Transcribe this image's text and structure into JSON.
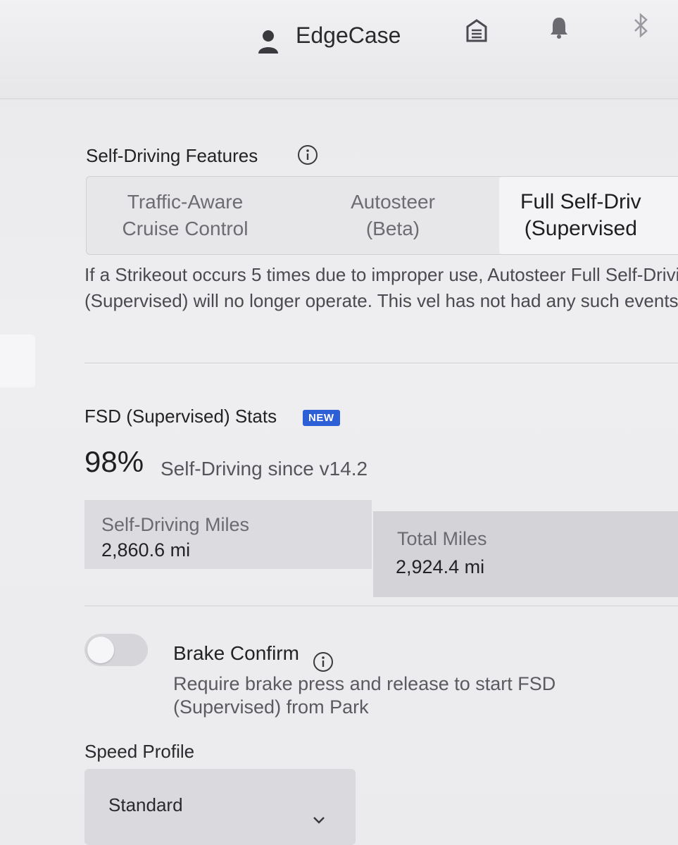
{
  "header": {
    "user_name": "EdgeCase",
    "icons": [
      "person-icon",
      "garage-icon",
      "bell-icon",
      "bluetooth-icon"
    ]
  },
  "self_driving": {
    "title": "Self-Driving Features",
    "options": [
      {
        "label": "Traffic-Aware\nCruise Control",
        "selected": false
      },
      {
        "label": "Autosteer\n(Beta)",
        "selected": false
      },
      {
        "label": "Full Self-Driv\n(Supervised",
        "selected": true
      }
    ],
    "description": "If a Strikeout occurs 5 times due to improper use, Autosteer Full Self-Driving (Supervised) will no longer operate. This vel has not had any such events."
  },
  "fsd_stats": {
    "title": "FSD (Supervised) Stats",
    "badge": "NEW",
    "percent": "98%",
    "percent_label": "Self-Driving since v14.2",
    "self_driving_miles_label": "Self-Driving Miles",
    "self_driving_miles_value": "2,860.6 mi",
    "total_miles_label": "Total Miles",
    "total_miles_value": "2,924.4 mi"
  },
  "brake_confirm": {
    "title": "Brake Confirm",
    "description": "Require brake press and release to start FSD (Supervised) from Park",
    "enabled": false
  },
  "speed_profile": {
    "label": "Speed Profile",
    "value": "Standard"
  },
  "colors": {
    "badge_blue": "#2d5fd6",
    "background": "#ececef"
  }
}
